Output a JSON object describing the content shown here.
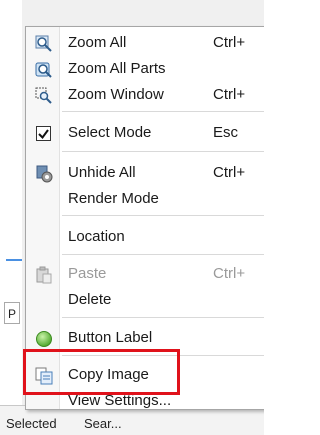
{
  "menu": {
    "items": [
      {
        "label": "Zoom All",
        "shortcut": "Ctrl+",
        "icon": "zoom-all-icon",
        "enabled": true
      },
      {
        "label": "Zoom All Parts",
        "shortcut": "",
        "icon": "zoom-all-parts-icon",
        "enabled": true
      },
      {
        "label": "Zoom Window",
        "shortcut": "Ctrl+",
        "icon": "zoom-window-icon",
        "enabled": true
      },
      {
        "label": "Select Mode",
        "shortcut": "Esc",
        "icon": "checkmark-icon",
        "enabled": true,
        "checked": true
      },
      {
        "label": "Unhide All",
        "shortcut": "Ctrl+",
        "icon": "unhide-all-icon",
        "enabled": true
      },
      {
        "label": "Render Mode",
        "shortcut": "",
        "icon": "",
        "enabled": true
      },
      {
        "label": "Location",
        "shortcut": "",
        "icon": "",
        "enabled": true
      },
      {
        "label": "Paste",
        "shortcut": "Ctrl+",
        "icon": "paste-icon",
        "enabled": false
      },
      {
        "label": "Delete",
        "shortcut": "",
        "icon": "",
        "enabled": true
      },
      {
        "label": "Button Label",
        "shortcut": "",
        "icon": "green-circle-icon",
        "enabled": true
      },
      {
        "label": "Copy Image",
        "shortcut": "",
        "icon": "copy-image-icon",
        "enabled": true,
        "highlighted": true
      },
      {
        "label": "View Settings...",
        "shortcut": "",
        "icon": "",
        "enabled": true
      }
    ]
  },
  "background": {
    "tab_label": "P",
    "bottom_left": "Selected",
    "bottom_right": "Sear..."
  },
  "colors": {
    "highlight_border": "#e0121b",
    "disabled_text": "#9a9a9a",
    "accent_blue": "#4a90e2"
  }
}
